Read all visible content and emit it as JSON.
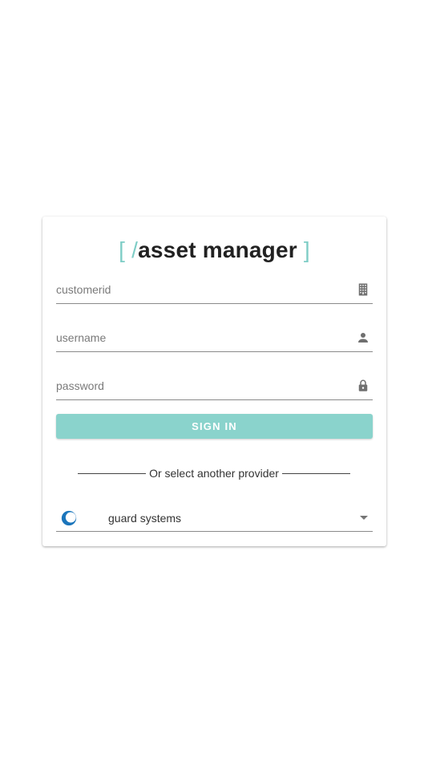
{
  "logo": {
    "bracket_open": "[",
    "slash": "/",
    "name": "asset manager",
    "bracket_close": "]"
  },
  "form": {
    "customerid_placeholder": "customerid",
    "username_placeholder": "username",
    "password_placeholder": "password",
    "signin_label": "SIGN IN"
  },
  "divider_text": "Or select another provider",
  "provider": {
    "selected": "guard systems",
    "icon": "guard-systems-logo"
  },
  "icons": {
    "customerid": "building-icon",
    "username": "person-icon",
    "password": "lock-icon"
  },
  "colors": {
    "accent": "#7ecdc6",
    "button": "#8ad3cc"
  }
}
